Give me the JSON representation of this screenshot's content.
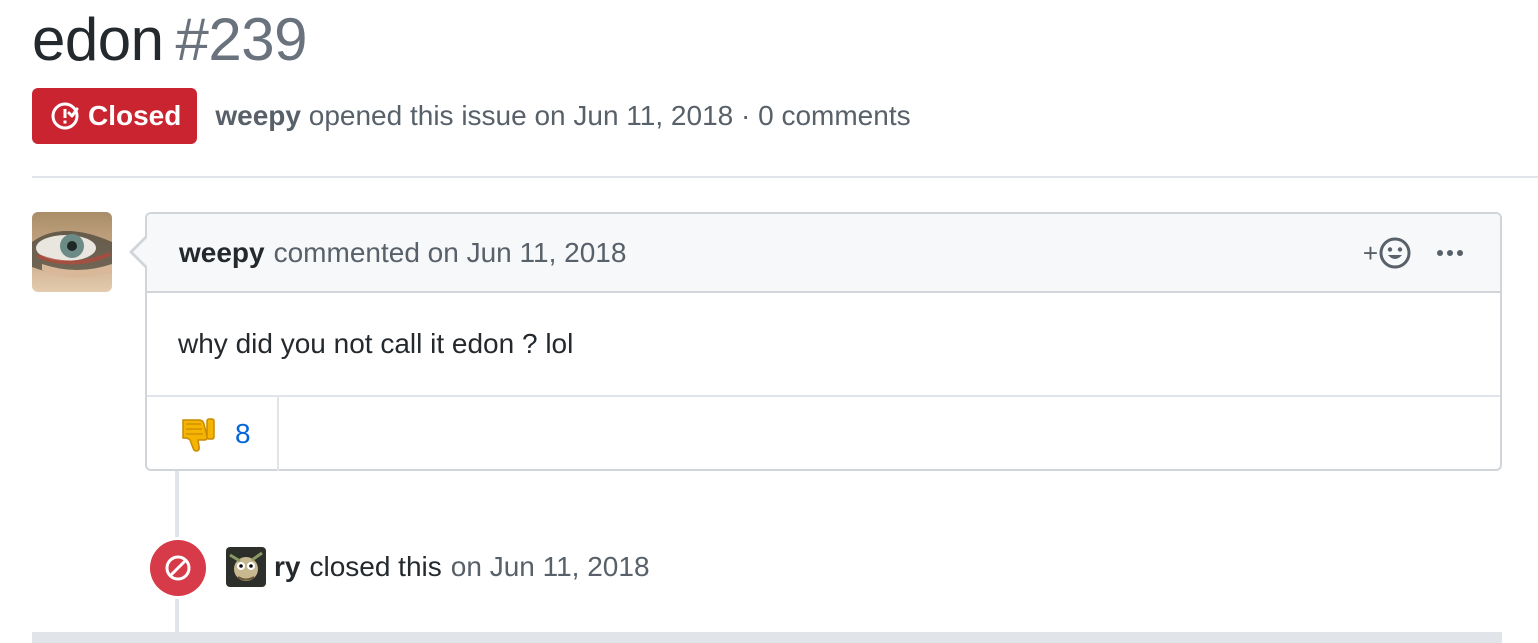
{
  "issue": {
    "title": "edon",
    "number": "#239",
    "state_label": "Closed",
    "state_color": "#cb2431",
    "author": "weepy",
    "meta_suffix": "opened this issue on Jun 11, 2018 · 0 comments"
  },
  "comment": {
    "author": "weepy",
    "timestamp_text": "commented on Jun 11, 2018",
    "add_reaction_plus": "+",
    "add_reaction_icon": "smiley-icon",
    "more_icon": "kebab-horizontal-icon",
    "body": "why did you not call it edon ? lol",
    "reactions": [
      {
        "emoji": "thumbs-down",
        "count": "8"
      }
    ]
  },
  "event": {
    "icon": "circle-slash-icon",
    "actor": "ry",
    "action": "closed this",
    "timestamp_text": "on Jun 11, 2018",
    "badge_color": "#d73a49"
  },
  "colors": {
    "link": "#0366d6",
    "muted": "#586069",
    "border": "#d1d5da"
  }
}
